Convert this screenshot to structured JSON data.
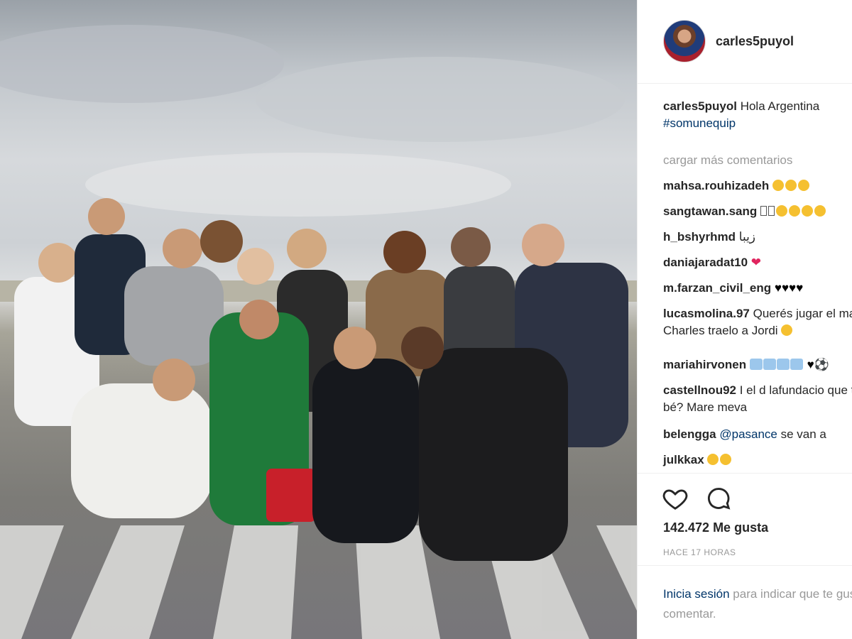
{
  "post": {
    "username": "carles5puyol",
    "caption_user": "carles5puyol",
    "caption_text": "Hola Argentina",
    "caption_hashtag": "#somunequip"
  },
  "comments_section": {
    "load_more": "cargar más comentarios",
    "items": [
      {
        "user": "mahsa.rouhizadeh",
        "text": ""
      },
      {
        "user": "sangtawan.sang",
        "text": ""
      },
      {
        "user": "h_bshyrhmd",
        "text": "زیبا"
      },
      {
        "user": "daniajaradat10",
        "text": ""
      },
      {
        "user": "m.farzan_civil_eng",
        "text": ""
      },
      {
        "user": "lucasmolina.97",
        "text": "Querés jugar el martes Charles traelo a Jordi"
      },
      {
        "user": "mariahirvonen",
        "text": ""
      },
      {
        "user": "castellnou92",
        "text": "I el d lafundacio que tracta bé? Mare meva"
      },
      {
        "user": "belengga",
        "text": "se van a",
        "mention": "@pasance"
      },
      {
        "user": "julkkax",
        "text": ""
      }
    ]
  },
  "actions": {
    "likes": "142.472 Me gusta",
    "timestamp": "HACE 17 HORAS"
  },
  "footer": {
    "login_link": "Inicia sesión",
    "login_text": "para indicar que te gusta o comentar."
  },
  "icons": [
    "heart-icon",
    "comment-icon",
    "avatar"
  ],
  "colors": {
    "link": "#003569",
    "muted": "#999999",
    "text": "#262626"
  }
}
